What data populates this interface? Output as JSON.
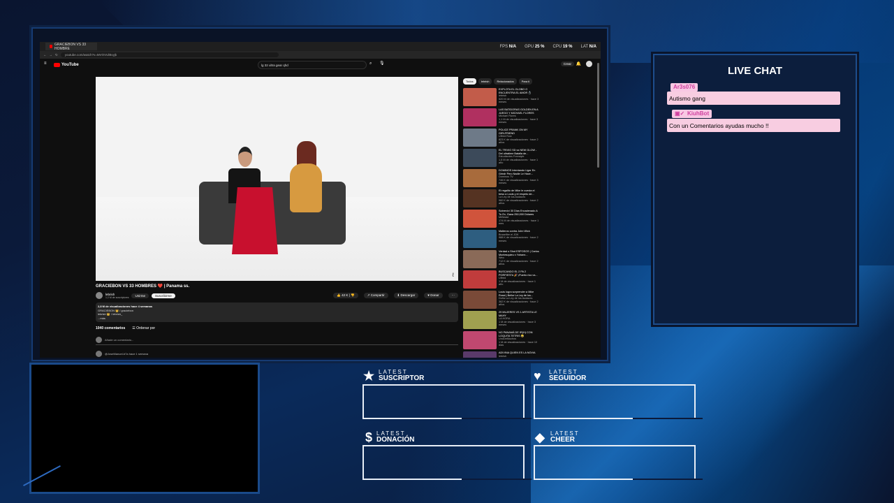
{
  "browser": {
    "tab_title": "GRACIEBON VS 33 HOMBRE",
    "url": "youtube.com/watch?v=MVOVUlBvyjk",
    "stats": [
      {
        "label": "FPS",
        "value": "N/A"
      },
      {
        "label": "GPU",
        "value": "25 %"
      },
      {
        "label": "CPU",
        "value": "19 %"
      },
      {
        "label": "LAT",
        "value": "N/A"
      }
    ]
  },
  "youtube": {
    "logo": "YouTube",
    "search_query": "lg 32 ultra gear qhd",
    "crear": "Crear",
    "video_title": "GRACIEBON VS 33 HOMBRES ❤️ | Panama ss.",
    "channel": "lebrish",
    "subscribers": "1.2 M de suscriptores",
    "unirme": "Unirme",
    "suscribirme": "Suscribirme",
    "likes": "42 K",
    "share": "Compartir",
    "download": "Descargar",
    "donate": "Donar",
    "description_line1": "2,8 M de visualizaciones  hace 4 semanas",
    "description_line2": "GRACIEBON 👑 / graciebon",
    "description_line3": "lebrish 👑 / lebrish_",
    "description_more": "...más",
    "comments_count": "1040 comentarios",
    "sort_label": "Ordenar por",
    "add_comment": "Añade un comentario...",
    "first_comment_user": "@JoseManuel-b7a hace 1 semana",
    "chips": [
      "Todos",
      "lebrish",
      "Relacionados",
      "Para ti"
    ],
    "related": [
      {
        "title": "EXPLOTA EL GLOBO O ENCUENTRA EL AMOR 💍",
        "channel": "lebrish",
        "meta": "520 M de visualizaciones · hace 3 meses",
        "color": "#c25c4a"
      },
      {
        "title": "LAS BATIDORAS GOLDEN EN A JUEGO Y MICHAEL FLORES",
        "channel": "Michael Flores",
        "meta": "1,1 M de visualizaciones · hace 3 meses",
        "color": "#b03060"
      },
      {
        "title": "POLICE PRANK ON MY GIRLFRIEND",
        "channel": "Ulfred Ruiz",
        "meta": "823 K de visualizaciones · hace 2 años",
        "color": "#6e7a88"
      },
      {
        "title": "EL TRIVIO SD vs NEW GLOW - Del ultratime Batalla de...",
        "channel": "Estudiantes Freestyle",
        "meta": "1,5 M de visualizaciones · hace 1 año",
        "color": "#3c4a5a"
      },
      {
        "title": "DOMINOS Intentando Ligar En Grindr Pero Nadie Le Hace...",
        "channel": "Dominos TV",
        "meta": "746 K de visualizaciones · hace 3 meses",
        "color": "#a86b3c"
      },
      {
        "title": "El regalito de Mike le cuesta el beso a Louis y el respeto de...",
        "channel": "La Ley de los Audaces",
        "meta": "960 K de visualizaciones · hace 2 años",
        "color": "#553322"
      },
      {
        "title": "Sobreviví 30 Días Encadenado A Tu Ex, Gana 250,000 Dólares",
        "channel": "MrBeast",
        "meta": "174 M de visualizaciones · hace 1 mes",
        "color": "#d0543c"
      },
      {
        "title": "Malteros contra John Wick",
        "channel": "Bruselfire el JOK",
        "meta": "988 K de visualizaciones · hace 2 meses",
        "color": "#2e5e80"
      },
      {
        "title": "Verdad o Shot ESPOSOS | Carlos Montesquieu x Yohann...",
        "channel": "Weo",
        "meta": "712 K de visualizaciones · hace 2 años",
        "color": "#8a6a58"
      },
      {
        "title": "BUSCANDO EL 2 PA 2 PORFIESTA 🎉 ¡Puerto rico vs...",
        "channel": "Ulfred",
        "meta": "1 M de visualizaciones · hace 1 año",
        "color": "#c03c3c"
      },
      {
        "title": "Louis logra sorprender a Mike Rossi | Bellor La Ley de los...",
        "channel": "Doña La Ley de los Audaces",
        "meta": "362 K de visualizaciones · hace 2 años",
        "color": "#7a4a38"
      },
      {
        "title": "29 MUJERES VS 1 ARTISTA LE MAHY",
        "channel": "LA HORA",
        "meta": "1 M de visualizaciones · hace 3 meses",
        "color": "#a0a050"
      },
      {
        "title": "NO PANAMÁ DE IR(H) CON LOQUITA TETRIS 😂",
        "channel": "UnoDeMuchos",
        "meta": "1 M de visualizaciones · hace 10 días",
        "color": "#c04870"
      },
      {
        "title": "ADIVINA QUIEN ES LA NOVIA",
        "channel": "lebrish",
        "meta": "",
        "color": "#5a3a6a"
      }
    ]
  },
  "chat": {
    "title": "LIVE CHAT",
    "messages": [
      {
        "user": "Ar3s076",
        "text": "Autismo gang"
      },
      {
        "user": "KiuhBot",
        "text": "Con un Comentarios ayudas mucho !!"
      }
    ]
  },
  "latest": [
    {
      "small": "LATEST",
      "big": "SUSCRIPTOR",
      "icon": "★"
    },
    {
      "small": "LATEST",
      "big": "SEGUIDOR",
      "icon": "♥"
    },
    {
      "small": "LATEST",
      "big": "DONACIÓN",
      "icon": "$"
    },
    {
      "small": "LATEST",
      "big": "CHEER",
      "icon": "◆"
    }
  ]
}
